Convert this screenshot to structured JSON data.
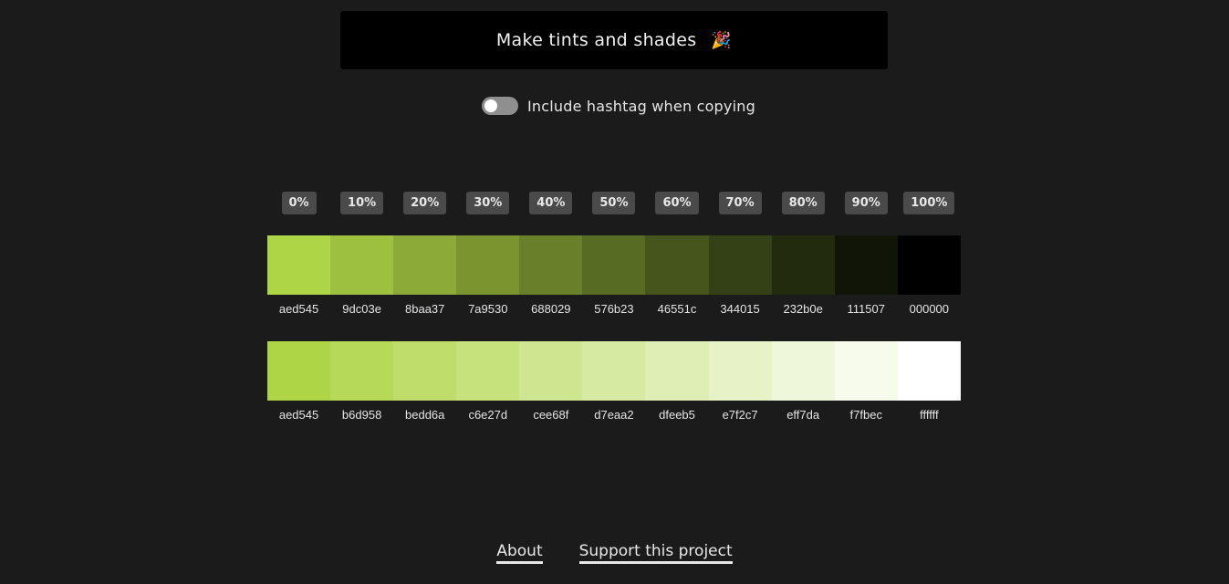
{
  "make_button": {
    "label": "Make tints and shades",
    "emoji": "🎉"
  },
  "toggle": {
    "label": "Include hashtag when copying",
    "checked": false
  },
  "percentages": [
    "0%",
    "10%",
    "20%",
    "30%",
    "40%",
    "50%",
    "60%",
    "70%",
    "80%",
    "90%",
    "100%"
  ],
  "shades": [
    "aed545",
    "9dc03e",
    "8baa37",
    "7a9530",
    "688029",
    "576b23",
    "46551c",
    "344015",
    "232b0e",
    "111507",
    "000000"
  ],
  "tints": [
    "aed545",
    "b6d958",
    "bedd6a",
    "c6e27d",
    "cee68f",
    "d7eaa2",
    "dfeeb5",
    "e7f2c7",
    "eff7da",
    "f7fbec",
    "ffffff"
  ],
  "footer": {
    "about": "About",
    "support": "Support this project"
  }
}
